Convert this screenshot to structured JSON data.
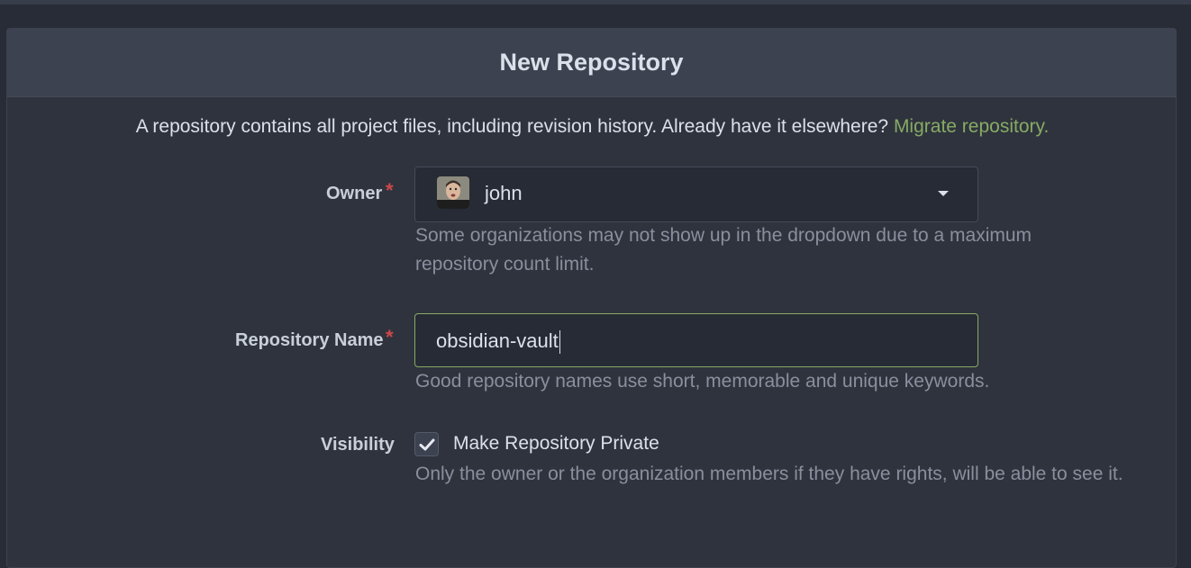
{
  "header": {
    "title": "New Repository"
  },
  "intro": {
    "text": "A repository contains all project files, including revision history. Already have it elsewhere?",
    "link_label": "Migrate repository."
  },
  "owner": {
    "label": "Owner",
    "required_mark": "*",
    "selected_value": "john",
    "avatar_icon": "user-avatar",
    "help": "Some organizations may not show up in the dropdown due to a maximum repository count limit."
  },
  "repo_name": {
    "label": "Repository Name",
    "required_mark": "*",
    "value": "obsidian-vault",
    "help": "Good repository names use short, memorable and unique keywords."
  },
  "visibility": {
    "label": "Visibility",
    "checkbox_label": "Make Repository Private",
    "checked": true,
    "help": "Only the owner or the organization members if they have rights, will be able to see it."
  },
  "colors": {
    "accent_green": "#87ab63",
    "required_red": "#cc4848",
    "background": "#282c37",
    "panel": "#2f333e"
  }
}
